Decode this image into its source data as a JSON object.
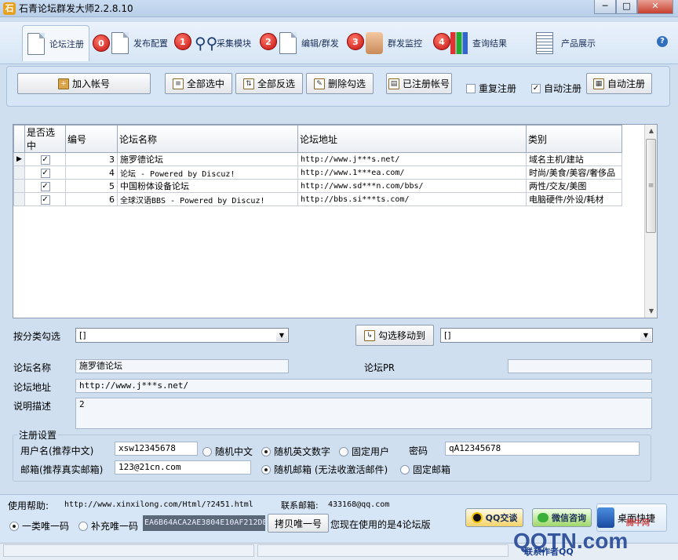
{
  "window": {
    "title": "石青论坛群发大师2.2.8.10",
    "minimize": "─",
    "maximize": "□",
    "close": "✕"
  },
  "nav": {
    "tabs": [
      {
        "label": "论坛注册",
        "badge": "0"
      },
      {
        "label": "发布配置",
        "badge": "1"
      },
      {
        "label": "采集模块",
        "badge": "2"
      },
      {
        "label": "编辑/群发",
        "badge": "3"
      },
      {
        "label": "群发监控",
        "badge": "4"
      },
      {
        "label": "查询结果"
      },
      {
        "label": "产品展示"
      }
    ],
    "help": "?"
  },
  "toolbar": {
    "add_account": "加入帐号",
    "select_all": "全部选中",
    "invert_select": "全部反选",
    "delete_checked": "删除勾选",
    "registered_accounts": "已注册帐号",
    "repeat_register": {
      "label": "重复注册",
      "checked": false
    },
    "auto_register_chk": {
      "label": "自动注册",
      "checked": true
    },
    "auto_register_btn": "自动注册"
  },
  "grid": {
    "columns": [
      "是否选中",
      "编号",
      "论坛名称",
      "论坛地址",
      "类别"
    ],
    "rows": [
      {
        "selected": true,
        "id": "3",
        "name": "施罗德论坛",
        "url": "http://www.j***s.net/",
        "category": "域名主机/建站"
      },
      {
        "selected": true,
        "id": "4",
        "name": "论坛 -  Powered by Discuz!",
        "url": "http://www.1***ea.com/",
        "category": "时尚/美食/美容/奢侈品"
      },
      {
        "selected": true,
        "id": "5",
        "name": "中国粉体设备论坛",
        "url": "http://www.sd***n.com/bbs/",
        "category": "两性/交友/美图"
      },
      {
        "selected": true,
        "id": "6",
        "name": " 全球汉语BBS  - Powered by Discuz!",
        "url": "http://bbs.si***ts.com/",
        "category": "电脑硬件/外设/耗材"
      }
    ]
  },
  "filter": {
    "category_label": "按分类勾选",
    "category_value": "[]",
    "move_button": "勾选移动到",
    "move_target": "[]"
  },
  "detail": {
    "name_label": "论坛名称",
    "name_value": "施罗德论坛",
    "pr_label": "论坛PR",
    "pr_value": "",
    "url_label": "论坛地址",
    "url_value": "http://www.j***s.net/",
    "desc_label": "说明描述",
    "desc_value": "2"
  },
  "register": {
    "group_title": "注册设置",
    "username_label": "用户名(推荐中文)",
    "username_value": "xsw12345678",
    "random_chinese": "随机中文",
    "random_alnum": "随机英文数字",
    "fixed_user": "固定用户",
    "password_label": "密码",
    "password_value": "qA12345678",
    "email_label": "邮箱(推荐真实邮箱)",
    "email_value": "123@21cn.com",
    "random_email": "随机邮箱 (无法收激活邮件)",
    "fixed_email": "固定邮箱"
  },
  "status": {
    "help_label": "使用帮助:",
    "help_url": "http://www.xinxilong.com/Html/?2451.html",
    "contact_label": "联系邮箱:",
    "contact_email": "433168@qq.com",
    "code_type_a": "一类唯一码",
    "code_type_b": "补充唯一码",
    "unique_code": "EA6B64ACA2AE3804E10AF212DE",
    "copy_button": "拷贝唯一号",
    "forum_count_text": "您现在使用的是4论坛版",
    "qq_button": "QQ交谈",
    "wechat_button": "微信咨询",
    "desktop_button": "桌面快捷",
    "contact_author": "联系作者QQ"
  },
  "watermark": "QQTN.com",
  "watermark_sub": "腾牛网"
}
